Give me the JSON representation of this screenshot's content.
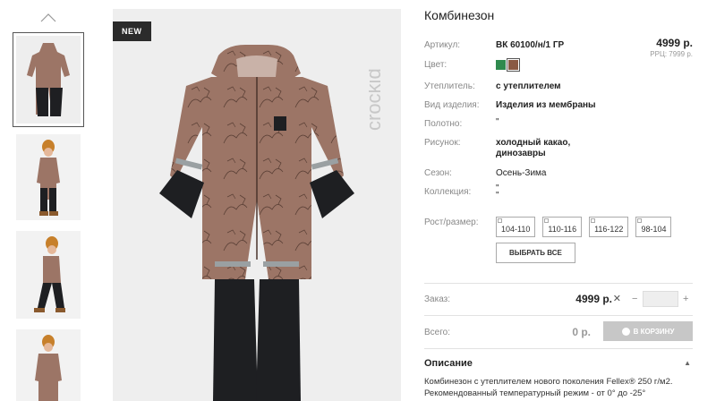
{
  "product": {
    "title": "Комбинезон",
    "badge": "NEW",
    "price": "4999 р.",
    "rrp": "РРЦ: 7999 р."
  },
  "attributes": [
    {
      "label": "Артикул:",
      "value": "ВК 60100/н/1 ГР"
    },
    {
      "label": "Цвет:"
    },
    {
      "label": "Утеплитель:",
      "value": "с утеплителем"
    },
    {
      "label": "Вид изделия:",
      "value": "Изделия из мембраны"
    },
    {
      "label": "Полотно:",
      "value": "\""
    },
    {
      "label": "Рисунок:",
      "value": "холодный какао,",
      "value2": "динозавры"
    },
    {
      "label": "Сезон:",
      "value": "Осень-Зима"
    },
    {
      "label": "Коллекция:",
      "value": "\"",
      "value2": "\""
    },
    {
      "label": "Рост/размер:"
    }
  ],
  "colors": [
    {
      "name": "green",
      "hex": "#2f8a4e"
    },
    {
      "name": "brown",
      "hex": "#8a5a44",
      "selected": true
    }
  ],
  "sizes": [
    "104-110",
    "110-116",
    "116-122",
    "98-104"
  ],
  "select_all_label": "ВЫБРАТЬ ВСЕ",
  "order": {
    "label": "Заказ:",
    "price": "4999 р.",
    "remove_symbol": "✕",
    "minus": "−",
    "plus": "+",
    "quantity": ""
  },
  "total": {
    "label": "Всего:",
    "value": "0 р."
  },
  "cart_button_label": "В КОРЗИНУ",
  "description": {
    "title": "Описание",
    "toggle_icon": "chevron-up-icon",
    "line1": "Комбинезон с утеплителем нового поколения Fellex® 250 г/м2.",
    "line2": "Рекомендованный температурный режим - от 0° до -25°"
  },
  "brand_watermark": "crockid",
  "accent_colors": {
    "suit_body": "#9c7566",
    "suit_dark": "#1e1f22",
    "hat_orange": "#c7802b"
  }
}
